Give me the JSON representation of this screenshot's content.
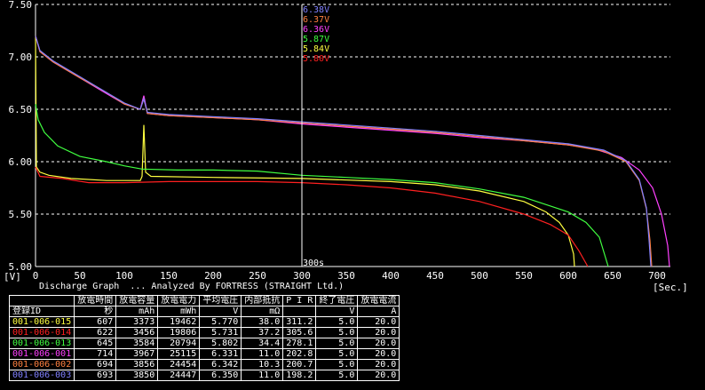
{
  "chart_data": {
    "type": "line",
    "title": "Discharge Graph",
    "subtitle": "Discharge Graph  ... Analyzed By FORTRESS (STRAIGHT Ltd.)",
    "ylabel": "[V]",
    "xlabel": "[Sec.]",
    "xlim": [
      0,
      715
    ],
    "ylim": [
      5.0,
      7.5
    ],
    "x_ticks": [
      0,
      50,
      100,
      150,
      200,
      250,
      300,
      350,
      400,
      450,
      500,
      550,
      600,
      650,
      700
    ],
    "y_ticks": [
      "5.00",
      "5.50",
      "6.00",
      "6.50",
      "7.00",
      "7.50"
    ],
    "grid": true,
    "cursor": {
      "x": 300,
      "label": "300s",
      "readouts": [
        {
          "text": "6.38V",
          "color": "#8080ff"
        },
        {
          "text": "6.37V",
          "color": "#ff8040"
        },
        {
          "text": "6.36V",
          "color": "#ff40ff"
        },
        {
          "text": "5.87V",
          "color": "#40ff40"
        },
        {
          "text": "5.84V",
          "color": "#ffff40"
        },
        {
          "text": "5.80V",
          "color": "#ff2020"
        }
      ]
    },
    "series": [
      {
        "name": "001-006-015",
        "color": "#ffff40",
        "points": [
          [
            0,
            7.2
          ],
          [
            1,
            5.95
          ],
          [
            5,
            5.9
          ],
          [
            15,
            5.87
          ],
          [
            40,
            5.84
          ],
          [
            80,
            5.82
          ],
          [
            118,
            5.82
          ],
          [
            120,
            5.86
          ],
          [
            122,
            6.35
          ],
          [
            124,
            5.9
          ],
          [
            130,
            5.86
          ],
          [
            200,
            5.85
          ],
          [
            300,
            5.84
          ],
          [
            400,
            5.81
          ],
          [
            450,
            5.78
          ],
          [
            500,
            5.72
          ],
          [
            550,
            5.62
          ],
          [
            575,
            5.52
          ],
          [
            590,
            5.42
          ],
          [
            600,
            5.3
          ],
          [
            606,
            5.12
          ],
          [
            607,
            5.0
          ]
        ]
      },
      {
        "name": "001-006-014",
        "color": "#ff2020",
        "points": [
          [
            0,
            5.95
          ],
          [
            5,
            5.86
          ],
          [
            30,
            5.84
          ],
          [
            60,
            5.8
          ],
          [
            100,
            5.8
          ],
          [
            150,
            5.81
          ],
          [
            200,
            5.81
          ],
          [
            250,
            5.81
          ],
          [
            300,
            5.8
          ],
          [
            350,
            5.78
          ],
          [
            400,
            5.75
          ],
          [
            450,
            5.7
          ],
          [
            500,
            5.62
          ],
          [
            550,
            5.5
          ],
          [
            580,
            5.4
          ],
          [
            600,
            5.3
          ],
          [
            612,
            5.15
          ],
          [
            622,
            5.0
          ]
        ]
      },
      {
        "name": "001-006-013",
        "color": "#40ff40",
        "points": [
          [
            0,
            6.55
          ],
          [
            3,
            6.4
          ],
          [
            10,
            6.28
          ],
          [
            25,
            6.15
          ],
          [
            50,
            6.05
          ],
          [
            80,
            6.0
          ],
          [
            100,
            5.96
          ],
          [
            120,
            5.93
          ],
          [
            160,
            5.92
          ],
          [
            200,
            5.92
          ],
          [
            250,
            5.91
          ],
          [
            300,
            5.87
          ],
          [
            350,
            5.85
          ],
          [
            400,
            5.83
          ],
          [
            450,
            5.8
          ],
          [
            500,
            5.74
          ],
          [
            550,
            5.66
          ],
          [
            600,
            5.52
          ],
          [
            620,
            5.42
          ],
          [
            635,
            5.28
          ],
          [
            645,
            5.0
          ]
        ]
      },
      {
        "name": "001-006-001",
        "color": "#ff40ff",
        "points": [
          [
            0,
            7.2
          ],
          [
            5,
            7.05
          ],
          [
            20,
            6.95
          ],
          [
            50,
            6.8
          ],
          [
            80,
            6.65
          ],
          [
            100,
            6.55
          ],
          [
            118,
            6.5
          ],
          [
            122,
            6.63
          ],
          [
            126,
            6.46
          ],
          [
            150,
            6.44
          ],
          [
            200,
            6.42
          ],
          [
            250,
            6.4
          ],
          [
            300,
            6.36
          ],
          [
            350,
            6.33
          ],
          [
            400,
            6.3
          ],
          [
            450,
            6.27
          ],
          [
            500,
            6.23
          ],
          [
            550,
            6.2
          ],
          [
            600,
            6.16
          ],
          [
            630,
            6.12
          ],
          [
            660,
            6.04
          ],
          [
            680,
            5.92
          ],
          [
            695,
            5.75
          ],
          [
            705,
            5.5
          ],
          [
            712,
            5.2
          ],
          [
            714,
            5.0
          ]
        ]
      },
      {
        "name": "001-006-002",
        "color": "#ff8040",
        "points": [
          [
            0,
            7.2
          ],
          [
            5,
            7.05
          ],
          [
            20,
            6.95
          ],
          [
            50,
            6.8
          ],
          [
            80,
            6.66
          ],
          [
            100,
            6.55
          ],
          [
            118,
            6.5
          ],
          [
            122,
            6.6
          ],
          [
            126,
            6.46
          ],
          [
            150,
            6.44
          ],
          [
            200,
            6.42
          ],
          [
            250,
            6.4
          ],
          [
            300,
            6.37
          ],
          [
            350,
            6.34
          ],
          [
            400,
            6.31
          ],
          [
            450,
            6.28
          ],
          [
            500,
            6.24
          ],
          [
            550,
            6.2
          ],
          [
            600,
            6.16
          ],
          [
            640,
            6.1
          ],
          [
            665,
            6.0
          ],
          [
            680,
            5.82
          ],
          [
            688,
            5.55
          ],
          [
            692,
            5.25
          ],
          [
            694,
            5.0
          ]
        ]
      },
      {
        "name": "001-006-003",
        "color": "#8080ff",
        "points": [
          [
            0,
            7.2
          ],
          [
            5,
            7.06
          ],
          [
            20,
            6.96
          ],
          [
            50,
            6.81
          ],
          [
            80,
            6.66
          ],
          [
            100,
            6.56
          ],
          [
            118,
            6.5
          ],
          [
            122,
            6.6
          ],
          [
            126,
            6.47
          ],
          [
            150,
            6.45
          ],
          [
            200,
            6.43
          ],
          [
            250,
            6.41
          ],
          [
            300,
            6.38
          ],
          [
            350,
            6.35
          ],
          [
            400,
            6.32
          ],
          [
            450,
            6.29
          ],
          [
            500,
            6.25
          ],
          [
            550,
            6.21
          ],
          [
            600,
            6.17
          ],
          [
            640,
            6.11
          ],
          [
            665,
            6.01
          ],
          [
            680,
            5.83
          ],
          [
            688,
            5.56
          ],
          [
            691,
            5.25
          ],
          [
            693,
            5.0
          ]
        ]
      }
    ]
  },
  "table": {
    "headers_row1": [
      "",
      "放電時間",
      "放電容量",
      "放電電力",
      "平均電圧",
      "内部抵抗",
      "P I R",
      "終了電圧",
      "放電電流"
    ],
    "headers_row2": [
      "登録ID",
      "秒",
      "mAh",
      "mWh",
      "V",
      "mΩ",
      "",
      "V",
      "A"
    ],
    "rows": [
      {
        "id": "001-006-015",
        "color": "#ffff40",
        "cells": [
          "607",
          "3373",
          "19462",
          "5.770",
          "38.0",
          "311.2",
          "5.0",
          "20.0"
        ]
      },
      {
        "id": "001-006-014",
        "color": "#ff2020",
        "cells": [
          "622",
          "3456",
          "19806",
          "5.731",
          "37.2",
          "305.6",
          "5.0",
          "20.0"
        ]
      },
      {
        "id": "001-006-013",
        "color": "#40ff40",
        "cells": [
          "645",
          "3584",
          "20794",
          "5.802",
          "34.4",
          "278.1",
          "5.0",
          "20.0"
        ]
      },
      {
        "id": "001-006-001",
        "color": "#ff40ff",
        "cells": [
          "714",
          "3967",
          "25115",
          "6.331",
          "11.0",
          "202.8",
          "5.0",
          "20.0"
        ]
      },
      {
        "id": "001-006-002",
        "color": "#ff8040",
        "cells": [
          "694",
          "3856",
          "24454",
          "6.342",
          "10.3",
          "200.7",
          "5.0",
          "20.0"
        ]
      },
      {
        "id": "001-006-003",
        "color": "#8080ff",
        "cells": [
          "693",
          "3850",
          "24447",
          "6.350",
          "11.0",
          "198.2",
          "5.0",
          "20.0"
        ]
      }
    ]
  }
}
